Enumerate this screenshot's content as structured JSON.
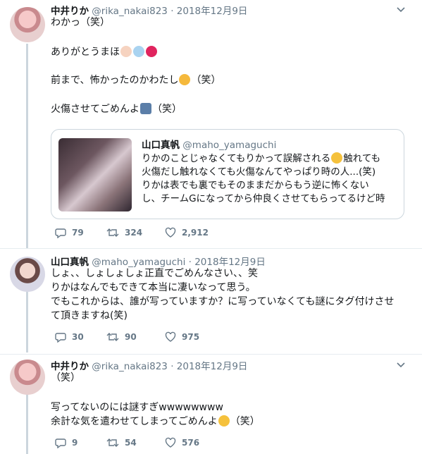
{
  "tweets": [
    {
      "name": "中井りか",
      "handle": "@rika_nakai823",
      "time": "· 2018年12月9日",
      "lines": [
        "わかっ（笑）",
        "ありがとうまほ",
        "前まで、怖かったのかわたし",
        "火傷させてごめんよ"
      ],
      "line4_suffix": "（笑）",
      "line5_suffix": "（笑）",
      "quote": {
        "name": "山口真帆",
        "handle": "@maho_yamaguchi",
        "lines": [
          "りかのことじゃなくてもりかって誤解される",
          "触れても",
          "火傷だし触れなくても火傷なんてやっぱり時の人...(笑)",
          "りかは表でも裏でもそのままだからもう逆に怖くない",
          "し、チームGになってから仲良くさせてもらってるけど時"
        ]
      },
      "replies": "79",
      "retweets": "324",
      "likes": "2,912"
    },
    {
      "name": "山口真帆",
      "handle": "@maho_yamaguchi",
      "time": "· 2018年12月9日",
      "lines": [
        "しょ、、しょしょしょ正直でごめんなさい、、笑",
        "りかはなんでもできて本当に凄いなって思う。",
        "でもこれからは、誰が写っていますか？に写っていなくても謎にタグ付けさせ",
        "て頂きますね(笑)"
      ],
      "replies": "30",
      "retweets": "90",
      "likes": "975"
    },
    {
      "name": "中井りか",
      "handle": "@rika_nakai823",
      "time": "· 2018年12月9日",
      "lines": [
        "（笑）",
        "写ってないのには謎すぎwwwwwwww",
        "余計な気を遣わせてしまってごめんよ"
      ],
      "line3_suffix": "（笑）",
      "replies": "9",
      "retweets": "54",
      "likes": "576"
    }
  ],
  "icons": {
    "reply": "reply-icon",
    "retweet": "retweet-icon",
    "like": "heart-icon",
    "more": "chevron-down-icon"
  },
  "colors": {
    "meta": "#657786",
    "border": "#ccd6dd"
  }
}
